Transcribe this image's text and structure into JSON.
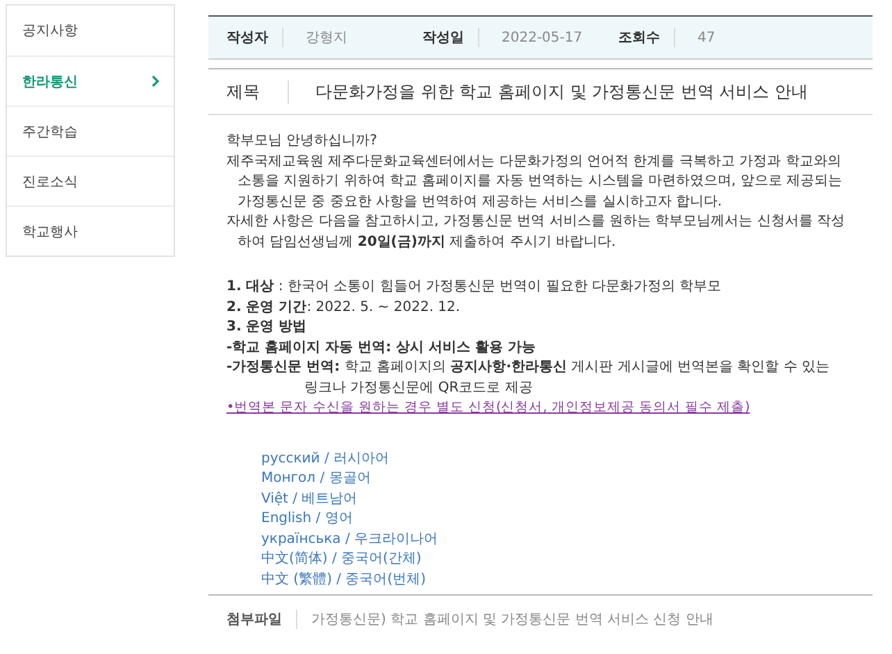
{
  "sidebar": {
    "items": [
      {
        "label": "공지사항",
        "selected": false
      },
      {
        "label": "한라통신",
        "selected": true
      },
      {
        "label": "주간학습",
        "selected": false
      },
      {
        "label": "진로소식",
        "selected": false
      },
      {
        "label": "학교행사",
        "selected": false
      }
    ]
  },
  "meta": [
    {
      "label": "작성자",
      "value": "강형지"
    },
    {
      "label": "작성일",
      "value": "2022-05-17"
    },
    {
      "label": "조회수",
      "value": "47"
    }
  ],
  "subject": {
    "label": "제목",
    "value": "다문화가정을 위한 학교 홈페이지 및 가정통신문 번역 서비스 안내"
  },
  "intro": [
    "학부모님 안녕하십니까?",
    "제주국제교육원 제주다문화교육센터에서는 다문화가정의 언어적 한계를 극복하고 가정과 학교와의 소통을 지원하기 위하여 학교 홈페이지를 자동 번역하는 시스템을 마련하였으며, 앞으로 제공되는 가정통신문 중 중요한 사항을 번역하여 제공하는 서비스를 실시하고자 합니다.",
    "자세한 사항은 다음을 참고하시고, 가정통신문 번역 서비스를 원하는 학부모님께서는 신청서를 작성하여 담임선생님께 **20일(금)까지** 제출하여 주시기 바랍니다."
  ],
  "details": [
    {
      "kind": "item",
      "text": "**1. 대상** : 한국어 소통이 힘들어 가정통신문 번역이 필요한 다문화가정의 학부모"
    },
    {
      "kind": "item",
      "text": "**2. 운영 기간**: 2022. 5. ~ 2022. 12."
    },
    {
      "kind": "heading",
      "text": "3. 운영 방법"
    },
    {
      "kind": "heading",
      "text": "-학교 홈페이지 자동 번역: 상시 서비스 활용 가능"
    },
    {
      "kind": "hanging",
      "text": "**-가정통신문 번역:** 학교 홈페이지의 **공지사항·한라통신** 게시판 게시글에 번역본을 확인할 수 있는 링크나 가정통신문에 QR코드로 제공"
    },
    {
      "kind": "link",
      "text": "•번역본 문자 수신을 원하는 경우 별도 신청(신청서, 개인정보제공 동의서 필수 제출)"
    }
  ],
  "languages": [
    "русский / 러시아어",
    "Монгол / 몽골어",
    "Việt / 베트남어",
    "English / 영어",
    "українська / 우크라이나어",
    "中文(简体) / 중국어(간체)",
    "中文 (繁體) / 중국어(번체)"
  ],
  "attachment": {
    "label": "첨부파일",
    "value": "가정통신문) 학교 홈페이지 및 가정통신문 번역 서비스 신청 안내"
  }
}
